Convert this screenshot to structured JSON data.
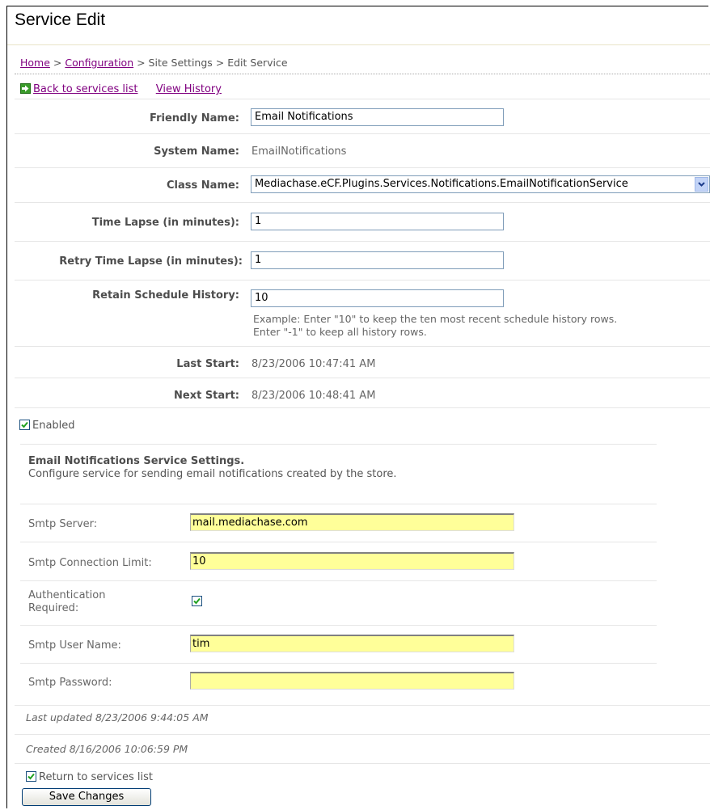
{
  "page": {
    "title": "Service Edit"
  },
  "breadcrumb": {
    "home": "Home",
    "sep1": " > ",
    "configuration": "Configuration",
    "rest": " > Site Settings > Edit Service"
  },
  "links": {
    "back": "Back to services list",
    "history": "View History"
  },
  "form": {
    "friendly_name": {
      "label": "Friendly Name:",
      "value": "Email Notifications"
    },
    "system_name": {
      "label": "System Name:",
      "value": "EmailNotifications"
    },
    "class_name": {
      "label": "Class Name:",
      "value": "Mediachase.eCF.Plugins.Services.Notifications.EmailNotificationService"
    },
    "time_lapse": {
      "label": "Time Lapse (in minutes):",
      "value": "1"
    },
    "retry_time_lapse": {
      "label": "Retry Time Lapse (in minutes):",
      "value": "1"
    },
    "retain_history": {
      "label": "Retain Schedule History:",
      "value": "10",
      "help_line1": "Example: Enter \"10\" to keep the ten most recent schedule history rows.",
      "help_line2": "Enter \"-1\" to keep all history rows."
    },
    "last_start": {
      "label": "Last Start:",
      "value": "8/23/2006 10:47:41 AM"
    },
    "next_start": {
      "label": "Next Start:",
      "value": "8/23/2006 10:48:41 AM"
    },
    "enabled": {
      "label": "Enabled",
      "checked": true
    }
  },
  "settings": {
    "title": "Email Notifications Service Settings.",
    "description": "Configure service for sending email notifications created by the store.",
    "smtp_server": {
      "label": "Smtp Server:",
      "value": "mail.mediachase.com"
    },
    "smtp_limit": {
      "label": "Smtp Connection Limit:",
      "value": "10"
    },
    "auth_required": {
      "label_line1": "Authentication",
      "label_line2": "Required:",
      "checked": true
    },
    "smtp_user": {
      "label": "Smtp User Name:",
      "value": "tim"
    },
    "smtp_password": {
      "label": "Smtp Password:",
      "value": ""
    }
  },
  "meta": {
    "last_updated": "Last updated 8/23/2006 9:44:05 AM",
    "created": "Created 8/16/2006 10:06:59 PM"
  },
  "footer": {
    "return_label": "Return to services list",
    "return_checked": true,
    "save_label": "Save Changes"
  },
  "colors": {
    "link": "#800080",
    "field_highlight": "#ffff99",
    "accent_border": "#7f9db9"
  }
}
